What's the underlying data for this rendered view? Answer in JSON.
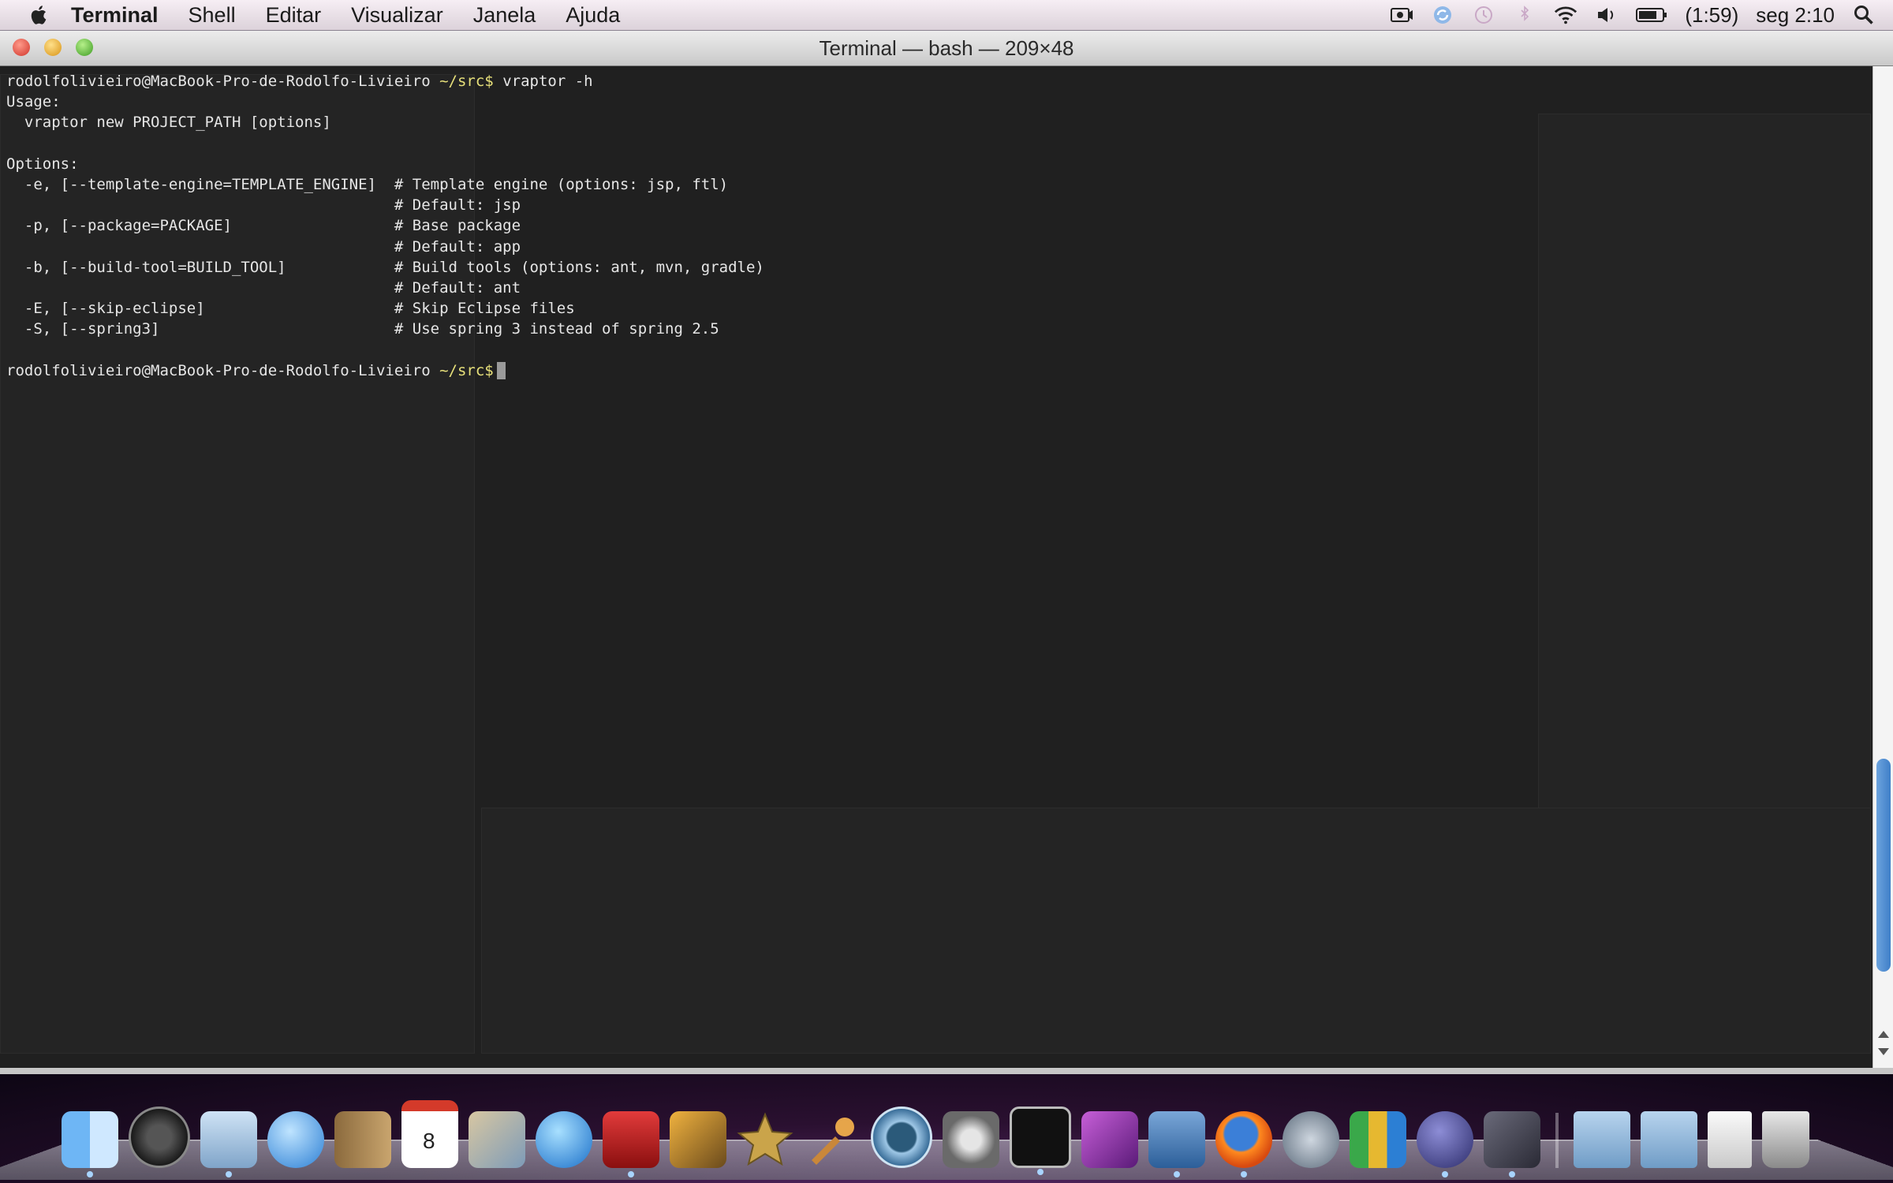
{
  "menubar": {
    "app_name": "Terminal",
    "menus": [
      "Shell",
      "Editar",
      "Visualizar",
      "Janela",
      "Ajuda"
    ],
    "battery_text": "(1:59)",
    "clock": "seg 2:10"
  },
  "window": {
    "title": "Terminal — bash — 209×48"
  },
  "terminal": {
    "prompt_user": "rodolfolivieiro@MacBook-Pro-de-Rodolfo-Livieiro",
    "prompt_path": "~/src$",
    "command": "vraptor -h",
    "output_lines": [
      "Usage:",
      "  vraptor new PROJECT_PATH [options]",
      "",
      "Options:",
      "  -e, [--template-engine=TEMPLATE_ENGINE]  # Template engine (options: jsp, ftl)",
      "                                           # Default: jsp",
      "  -p, [--package=PACKAGE]                  # Base package",
      "                                           # Default: app",
      "  -b, [--build-tool=BUILD_TOOL]            # Build tools (options: ant, mvn, gradle)",
      "                                           # Default: ant",
      "  -E, [--skip-eclipse]                     # Skip Eclipse files",
      "  -S, [--spring3]                          # Use spring 3 instead of spring 2.5",
      ""
    ],
    "scroll_position": 0.93
  },
  "dock": {
    "apps": [
      "finder-icon",
      "dashboard-icon",
      "mail-icon",
      "ichat-icon",
      "address-book-icon",
      "ical-icon",
      "iphoto-icon",
      "itunes-icon",
      "photo-booth-icon",
      "preview-icon",
      "imovie-icon",
      "garageband-icon",
      "time-machine-icon",
      "system-preferences-icon",
      "terminal-icon",
      "xcode-instruments-icon",
      "keynote-icon",
      "firefox-icon",
      "safari-tool-icon",
      "numbers-icon",
      "eclipse-icon",
      "quicktime-icon"
    ],
    "folders": [
      "applications-folder-icon",
      "documents-folder-icon",
      "downloads-stack-icon",
      "trash-icon"
    ]
  }
}
